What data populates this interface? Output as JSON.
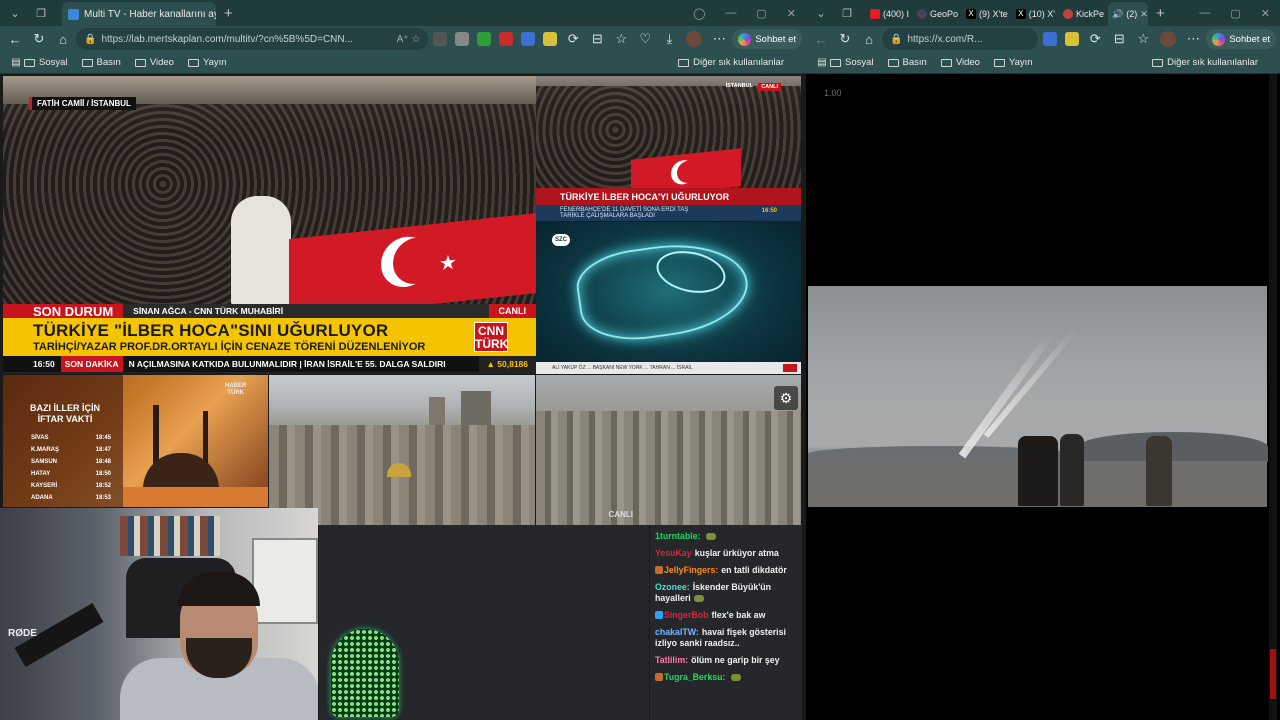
{
  "left_window": {
    "tabs": [
      {
        "title": "Multi TV - Haber kanallarını aynı a",
        "active": true
      }
    ],
    "url": "https://lab.mertskaplan.com/multitv/?cn%5B%5D=CNN...",
    "copilot_label": "Sohbet et",
    "bookmarks": [
      "Sosyal",
      "Basın",
      "Video",
      "Yayın"
    ],
    "other_bookmarks": "Diğer sık kullanılanlar"
  },
  "right_window": {
    "tabs": [
      {
        "title": "(400) I",
        "favicon": "youtube"
      },
      {
        "title": "GeoPo",
        "favicon": "geopol"
      },
      {
        "title": "(9) X'te",
        "favicon": "x"
      },
      {
        "title": "(10) X'",
        "favicon": "x"
      },
      {
        "title": "KickPe",
        "favicon": "kick"
      },
      {
        "title": "(2)",
        "favicon": "audio",
        "active": true
      }
    ],
    "url": "https://x.com/R...",
    "copilot_label": "Sohbet et",
    "bookmarks": [
      "Sosyal",
      "Basın",
      "Video",
      "Yayın"
    ],
    "other_bookmarks": "Diğer sık kullanılanlar",
    "speed_label": "1.00"
  },
  "cnn_main": {
    "location": "FATİH CAMİİ / İSTANBUL",
    "son_durum": "SON DURUM",
    "reporter": "SİNAN AĞCA - CNN TÜRK MUHABİRİ",
    "live": "CANLI",
    "headline": "TÜRKİYE \"İLBER HOCA\"SINI UĞURLUYOR",
    "subheadline": "TARİHÇİ/YAZAR PROF.DR.ORTAYLI İÇİN CENAZE TÖRENİ DÜZENLENİYOR",
    "logo_line1": "CNN",
    "logo_line2": "TÜRK",
    "time": "16:50",
    "breaking": "SON DAKİKA",
    "ticker": "N AÇILMASINA KATKIDA BULUNMALIDIR  |  İRAN İSRAİL'E 55. DALGA SALDIRI",
    "bist": "▲ 50,8186"
  },
  "top_right_tv": {
    "headline": "TÜRKİYE İLBER HOCA'YI UĞURLUYOR",
    "sub": "FENERBAHÇE'DE 11 DAVETİ SONA ERDİ TAŞ",
    "sub2": "TARİKLE ÇALIŞMALARA BAŞLADI",
    "time": "16:50",
    "tag": "CANLI",
    "tag2": "İSTANBUL"
  },
  "szc_tv": {
    "logo": "SZC",
    "ticker": "ALİ YAKUP ÖZ ... BAŞKANI NEW YORK ... TAHRAN ... İSRAİL"
  },
  "haberturk": {
    "logo_line1": "HABER",
    "logo_line2": "TÜRK",
    "title": "BAZI İLLER İÇİN İFTAR VAKTİ",
    "cities": [
      {
        "name": "SİVAS",
        "time": "18:45"
      },
      {
        "name": "K.MARAŞ",
        "time": "18:47"
      },
      {
        "name": "SAMSUN",
        "time": "18:48"
      },
      {
        "name": "HATAY",
        "time": "18:50"
      },
      {
        "name": "KAYSERİ",
        "time": "18:52"
      },
      {
        "name": "ADANA",
        "time": "18:53"
      }
    ]
  },
  "city_cam": {
    "watermark": "CANLI"
  },
  "webcam": {
    "mic_brand": "RØDE"
  },
  "chat": [
    {
      "user": "1turntable:",
      "color": "#1ed760",
      "text": "",
      "emote": true
    },
    {
      "user": "YesuKay",
      "color": "#e0223a",
      "text": "kuşlar ürküyor atma",
      "emote": false
    },
    {
      "user": "JellyFingers:",
      "color": "#ff8c1a",
      "text": "en tatli dikdatör",
      "emote": false,
      "badge": "#c96b2c"
    },
    {
      "user": "Ozonee:",
      "color": "#46e0d0",
      "text": "İskender Büyük'ün hayalleri",
      "emote": true
    },
    {
      "user": "SingerBob",
      "color": "#e0223a",
      "text": "flex'e bak aw",
      "emote": false,
      "badge": "#2aa4f4"
    },
    {
      "user": "chakalTW:",
      "color": "#7ab4ff",
      "text": "havai fişek gösterisi izliyo sanki raadsız..",
      "emote": false
    },
    {
      "user": "Tatlilim:",
      "color": "#ff7aa8",
      "text": "ölüm ne garip bir şey",
      "emote": false
    },
    {
      "user": "Tugra_Berksu:",
      "color": "#1ed760",
      "text": "",
      "emote": true,
      "badge": "#c96b2c"
    }
  ]
}
